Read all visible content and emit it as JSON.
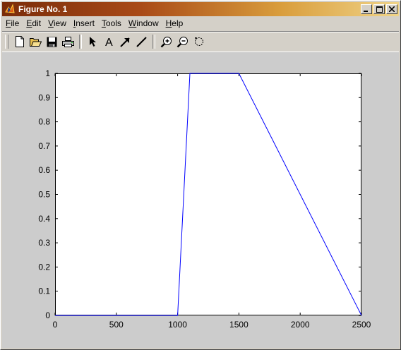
{
  "window": {
    "title": "Figure No. 1",
    "app_icon": "matlab-icon",
    "controls": [
      "minimize-icon",
      "maximize-icon",
      "close-icon"
    ]
  },
  "menubar": {
    "items": [
      {
        "label": "File",
        "access": "F",
        "rest": "ile"
      },
      {
        "label": "Edit",
        "access": "E",
        "rest": "dit"
      },
      {
        "label": "View",
        "access": "V",
        "rest": "iew"
      },
      {
        "label": "Insert",
        "access": "I",
        "rest": "nsert"
      },
      {
        "label": "Tools",
        "access": "T",
        "rest": "ools"
      },
      {
        "label": "Window",
        "access": "W",
        "rest": "indow"
      },
      {
        "label": "Help",
        "access": "H",
        "rest": "elp"
      }
    ]
  },
  "toolbar": {
    "buttons": [
      "new-file-icon",
      "open-folder-icon",
      "save-icon",
      "print-icon",
      "select-arrow-icon",
      "insert-text-icon",
      "insert-arrow-icon",
      "insert-line-icon",
      "zoom-in-icon",
      "zoom-out-icon",
      "rotate-icon"
    ]
  },
  "colors": {
    "background": "#cccccc",
    "axes": "#ffffff",
    "line": "#0000ff",
    "title_gradient_start": "#7a2c0a",
    "title_gradient_end": "#f0d488"
  },
  "chart_data": {
    "type": "line",
    "title": "",
    "xlabel": "",
    "ylabel": "",
    "xlim": [
      0,
      2500
    ],
    "ylim": [
      0,
      1
    ],
    "xticks": [
      0,
      500,
      1000,
      1500,
      2000,
      2500
    ],
    "yticks": [
      0,
      0.1,
      0.2,
      0.3,
      0.4,
      0.5,
      0.6,
      0.7,
      0.8,
      0.9,
      1
    ],
    "grid": false,
    "series": [
      {
        "color": "#0000ff",
        "x": [
          0,
          1000,
          1100,
          1500,
          2500
        ],
        "y": [
          0,
          0,
          1,
          1,
          0
        ]
      }
    ]
  }
}
